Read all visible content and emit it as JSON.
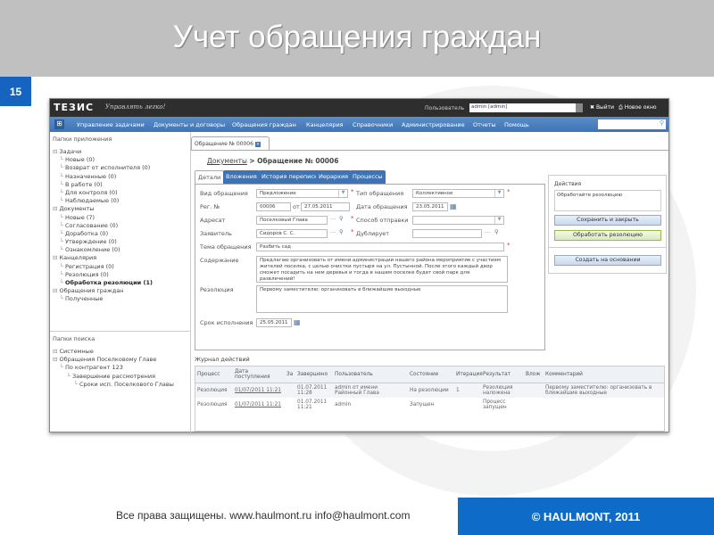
{
  "slide": {
    "title": "Учет обращения граждан",
    "number": "15",
    "footer_text": "Все права защищены. www.haulmont.ru info@haulmont.com",
    "copyright": "© HAULMONT, 2011",
    "accent": "#0f6bc8"
  },
  "app": {
    "logo": "ТЕЗИС",
    "slogan": "Управлять легко!",
    "user_label": "Пользователь",
    "user_value": "admin [admin]",
    "logout": "Выйти",
    "new_window": "Новое окно",
    "menu": [
      "Управление задачами",
      "Документы и договоры",
      "Обращения граждан",
      "Канцелярия",
      "Справочники",
      "Администрирование",
      "Отчеты",
      "Помощь"
    ]
  },
  "sidebar": {
    "app_folders_title": "Папки приложения",
    "app_folders": [
      {
        "label": "Задачи",
        "level": 0
      },
      {
        "label": "Новые (0)",
        "level": 1
      },
      {
        "label": "Возврат от исполнителя (0)",
        "level": 1
      },
      {
        "label": "Назначенные (0)",
        "level": 1
      },
      {
        "label": "В работе (0)",
        "level": 1
      },
      {
        "label": "Для контроля (0)",
        "level": 1
      },
      {
        "label": "Наблюдаемые (0)",
        "level": 1
      },
      {
        "label": "Документы",
        "level": 0
      },
      {
        "label": "Новые (7)",
        "level": 1
      },
      {
        "label": "Согласование (0)",
        "level": 1
      },
      {
        "label": "Доработка (0)",
        "level": 1
      },
      {
        "label": "Утверждение (0)",
        "level": 1
      },
      {
        "label": "Ознакомление (0)",
        "level": 1
      },
      {
        "label": "Канцелярия",
        "level": 0
      },
      {
        "label": "Регистрация (0)",
        "level": 1
      },
      {
        "label": "Резолюция (0)",
        "level": 1
      },
      {
        "label": "Обработка резолюции (1)",
        "level": 1,
        "bold": true
      },
      {
        "label": "Обращения граждан",
        "level": 0
      },
      {
        "label": "Полученные",
        "level": 1
      }
    ],
    "search_folders_title": "Папки поиска",
    "search_folders": [
      {
        "label": "Системные",
        "level": 0
      },
      {
        "label": "Обращения Поселковому Главе",
        "level": 0
      },
      {
        "label": "По контрагент 123",
        "level": 1
      },
      {
        "label": "Завершение рассмотрения",
        "level": 2
      },
      {
        "label": "Сроки исп. Поселкового Главы",
        "level": 3
      }
    ]
  },
  "doc": {
    "tab": "Обращение № 00006",
    "breadcrumb_link": "Документы",
    "breadcrumb_current": "> Обращение № 00006",
    "subtabs": [
      "Детали",
      "Вложения",
      "История переписки",
      "Иерархия",
      "Процессы"
    ],
    "fields": {
      "vid_label": "Вид обращения",
      "vid": "Предложение",
      "tip_label": "Тип обращения",
      "tip": "Коллективное",
      "reg_label": "Рег. №",
      "reg": "00006",
      "ot": "от",
      "reg_date": "27.05.2011",
      "data_label": "Дата обращения",
      "data": "23.05.2011",
      "adresat_label": "Адресат",
      "adresat": "Поселковый Глава",
      "sposob_label": "Способ отправки",
      "sposob": "",
      "zayavitel_label": "Заявитель",
      "zayavitel": "Сидоров С. С.",
      "dubl_label": "Дублирует",
      "dubl": "",
      "tema_label": "Тема обращения",
      "tema": "Разбить сад",
      "soderzhanie_label": "Содержание",
      "soderzhanie": "Предлагаю организовать от имени администрации нашего района мероприятие с участием жителей поселка, с целью очистки пустыря на ул. Пустынной. После этого каждый двор сможет посадить на нем деревья и тогда в нашем поселке будет свой парк для развлечений!",
      "rezolyutsiya_label": "Резолюция",
      "rezolyutsiya": "Первому заместителю: организовать в ближайшие выходные",
      "srok_label": "Срок исполнения",
      "srok": "25.05.2011"
    },
    "actions": {
      "title": "Действия",
      "hint": "Обработайте резолюцию",
      "save_close": "Сохранить и закрыть",
      "process": "Обработать резолюцию",
      "create_based": "Создать на основании"
    }
  },
  "journal": {
    "title": "Журнал действий",
    "columns": [
      "Процесс",
      "Дата поступления",
      "За",
      "Завершено",
      "Пользователь",
      "Состояние",
      "Итерация",
      "Результат",
      "Влож",
      "Комментарий"
    ],
    "rows": [
      [
        "Резолюция",
        "01/07/2011 11:21",
        "",
        "01.07.2011 11:28",
        "admin от имени Районный Глава",
        "На резолюции",
        "1",
        "Резолюция наложена",
        "",
        "Первому заместителю: организовать в ближайшие выходные"
      ],
      [
        "Резолюция",
        "01/07/2011 11:21",
        "",
        "01.07.2011 11:21",
        "admin",
        "Запущен",
        "",
        "Процесс запущен",
        "",
        ""
      ]
    ]
  }
}
